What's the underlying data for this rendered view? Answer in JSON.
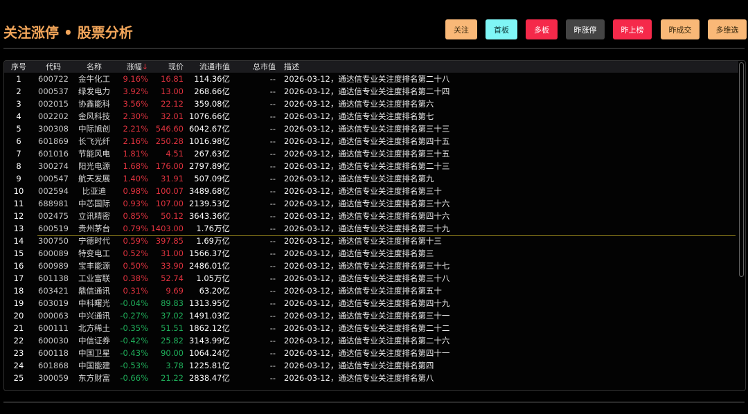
{
  "header": {
    "title": "关注涨停 • 股票分析"
  },
  "buttons": [
    {
      "label": "关注",
      "bg": "#f9b877",
      "fg": "#3a2a10"
    },
    {
      "label": "首板",
      "bg": "#7ff6f6",
      "fg": "#103a3a"
    },
    {
      "label": "多板",
      "bg": "#f5294a",
      "fg": "#ffffff"
    },
    {
      "label": "昨涨停",
      "bg": "#444444",
      "fg": "#ffffff"
    },
    {
      "label": "昨上榜",
      "bg": "#f5294a",
      "fg": "#ffffff"
    },
    {
      "label": "昨成交",
      "bg": "#f9b877",
      "fg": "#3a2a10"
    },
    {
      "label": "多维选",
      "bg": "#f9b877",
      "fg": "#3a2a10"
    }
  ],
  "colors": {
    "up": "#e0333f",
    "down": "#1fae5a",
    "title": "#f3a65a"
  },
  "table": {
    "columns": {
      "idx": "序号",
      "code": "代码",
      "name": "名称",
      "chg": "涨幅",
      "sort_arrow": "↓",
      "price": "现价",
      "float_cap": "流通市值",
      "total_cap": "总市值",
      "desc": "描述"
    },
    "rows": [
      {
        "idx": "1",
        "code": "600722",
        "name": "金牛化工",
        "chg": "9.16%",
        "price": "16.81",
        "float_cap": "114.36亿",
        "total_cap": "--",
        "desc": "2026-03-12，通达信专业关注度排名第二十八"
      },
      {
        "idx": "2",
        "code": "000537",
        "name": "绿发电力",
        "chg": "3.92%",
        "price": "13.00",
        "float_cap": "268.66亿",
        "total_cap": "--",
        "desc": "2026-03-12，通达信专业关注度排名第二十四"
      },
      {
        "idx": "3",
        "code": "002015",
        "name": "协鑫能科",
        "chg": "3.56%",
        "price": "22.12",
        "float_cap": "359.08亿",
        "total_cap": "--",
        "desc": "2026-03-12，通达信专业关注度排名第六"
      },
      {
        "idx": "4",
        "code": "002202",
        "name": "金风科技",
        "chg": "2.30%",
        "price": "32.01",
        "float_cap": "1076.66亿",
        "total_cap": "--",
        "desc": "2026-03-12，通达信专业关注度排名第七"
      },
      {
        "idx": "5",
        "code": "300308",
        "name": "中际旭创",
        "chg": "2.21%",
        "price": "546.60",
        "float_cap": "6042.67亿",
        "total_cap": "--",
        "desc": "2026-03-12，通达信专业关注度排名第三十三"
      },
      {
        "idx": "6",
        "code": "601869",
        "name": "长飞光纤",
        "chg": "2.16%",
        "price": "250.28",
        "float_cap": "1016.98亿",
        "total_cap": "--",
        "desc": "2026-03-12，通达信专业关注度排名第四十五"
      },
      {
        "idx": "7",
        "code": "601016",
        "name": "节能风电",
        "chg": "1.81%",
        "price": "4.51",
        "float_cap": "267.63亿",
        "total_cap": "--",
        "desc": "2026-03-12，通达信专业关注度排名第三十五"
      },
      {
        "idx": "8",
        "code": "300274",
        "name": "阳光电源",
        "chg": "1.68%",
        "price": "176.00",
        "float_cap": "2797.89亿",
        "total_cap": "--",
        "desc": "2026-03-12，通达信专业关注度排名第二十三"
      },
      {
        "idx": "9",
        "code": "000547",
        "name": "航天发展",
        "chg": "1.40%",
        "price": "31.91",
        "float_cap": "507.09亿",
        "total_cap": "--",
        "desc": "2026-03-12，通达信专业关注度排名第九"
      },
      {
        "idx": "10",
        "code": "002594",
        "name": "比亚迪",
        "chg": "0.98%",
        "price": "100.07",
        "float_cap": "3489.68亿",
        "total_cap": "--",
        "desc": "2026-03-12，通达信专业关注度排名第三十"
      },
      {
        "idx": "11",
        "code": "688981",
        "name": "中芯国际",
        "chg": "0.93%",
        "price": "107.00",
        "float_cap": "2139.53亿",
        "total_cap": "--",
        "desc": "2026-03-12，通达信专业关注度排名第三十六"
      },
      {
        "idx": "12",
        "code": "002475",
        "name": "立讯精密",
        "chg": "0.85%",
        "price": "50.12",
        "float_cap": "3643.36亿",
        "total_cap": "--",
        "desc": "2026-03-12，通达信专业关注度排名第四十六"
      },
      {
        "idx": "13",
        "code": "600519",
        "name": "贵州茅台",
        "chg": "0.79%",
        "price": "1403.00",
        "float_cap": "1.76万亿",
        "total_cap": "--",
        "desc": "2026-03-12，通达信专业关注度排名第三十九"
      },
      {
        "idx": "14",
        "code": "300750",
        "name": "宁德时代",
        "chg": "0.59%",
        "price": "397.85",
        "float_cap": "1.69万亿",
        "total_cap": "--",
        "desc": "2026-03-12，通达信专业关注度排名第十三"
      },
      {
        "idx": "15",
        "code": "600089",
        "name": "特变电工",
        "chg": "0.52%",
        "price": "31.00",
        "float_cap": "1566.37亿",
        "total_cap": "--",
        "desc": "2026-03-12，通达信专业关注度排名第三"
      },
      {
        "idx": "16",
        "code": "600989",
        "name": "宝丰能源",
        "chg": "0.50%",
        "price": "33.90",
        "float_cap": "2486.01亿",
        "total_cap": "--",
        "desc": "2026-03-12，通达信专业关注度排名第三十七"
      },
      {
        "idx": "17",
        "code": "601138",
        "name": "工业富联",
        "chg": "0.38%",
        "price": "52.74",
        "float_cap": "1.05万亿",
        "total_cap": "--",
        "desc": "2026-03-12，通达信专业关注度排名第三十八"
      },
      {
        "idx": "18",
        "code": "603421",
        "name": "鼎信通讯",
        "chg": "0.31%",
        "price": "9.69",
        "float_cap": "63.20亿",
        "total_cap": "--",
        "desc": "2026-03-12，通达信专业关注度排名第五十"
      },
      {
        "idx": "19",
        "code": "603019",
        "name": "中科曙光",
        "chg": "-0.04%",
        "price": "89.83",
        "float_cap": "1313.95亿",
        "total_cap": "--",
        "desc": "2026-03-12，通达信专业关注度排名第四十九"
      },
      {
        "idx": "20",
        "code": "000063",
        "name": "中兴通讯",
        "chg": "-0.27%",
        "price": "37.02",
        "float_cap": "1491.03亿",
        "total_cap": "--",
        "desc": "2026-03-12，通达信专业关注度排名第三十一"
      },
      {
        "idx": "21",
        "code": "600111",
        "name": "北方稀土",
        "chg": "-0.35%",
        "price": "51.51",
        "float_cap": "1862.12亿",
        "total_cap": "--",
        "desc": "2026-03-12，通达信专业关注度排名第二十二"
      },
      {
        "idx": "22",
        "code": "600030",
        "name": "中信证券",
        "chg": "-0.42%",
        "price": "25.82",
        "float_cap": "3143.99亿",
        "total_cap": "--",
        "desc": "2026-03-12，通达信专业关注度排名第二十六"
      },
      {
        "idx": "23",
        "code": "600118",
        "name": "中国卫星",
        "chg": "-0.43%",
        "price": "90.00",
        "float_cap": "1064.24亿",
        "total_cap": "--",
        "desc": "2026-03-12，通达信专业关注度排名第四十一"
      },
      {
        "idx": "24",
        "code": "601868",
        "name": "中国能建",
        "chg": "-0.53%",
        "price": "3.78",
        "float_cap": "1225.81亿",
        "total_cap": "--",
        "desc": "2026-03-12，通达信专业关注度排名第四"
      },
      {
        "idx": "25",
        "code": "300059",
        "name": "东方财富",
        "chg": "-0.66%",
        "price": "21.22",
        "float_cap": "2838.47亿",
        "total_cap": "--",
        "desc": "2026-03-12，通达信专业关注度排名第八"
      }
    ]
  }
}
